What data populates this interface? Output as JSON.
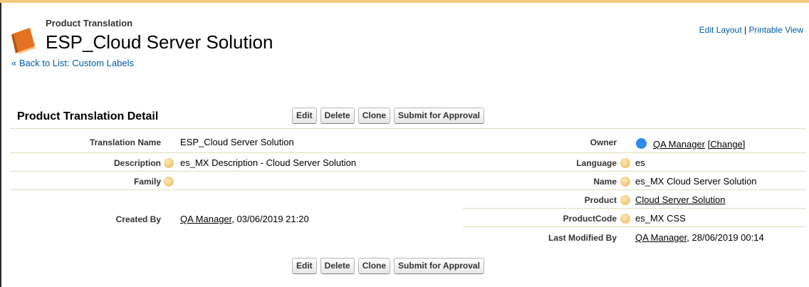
{
  "header": {
    "eyebrow": "Product Translation",
    "title": "ESP_Cloud Server Solution",
    "back_link": "« Back to List: Custom Labels",
    "edit_layout": "Edit Layout",
    "separator": "|",
    "printable_view": "Printable View"
  },
  "section": {
    "title": "Product Translation Detail"
  },
  "buttons": {
    "edit": "Edit",
    "delete": "Delete",
    "clone": "Clone",
    "submit": "Submit for Approval"
  },
  "fields": {
    "translation_name": {
      "label": "Translation Name",
      "value": "ESP_Cloud Server Solution"
    },
    "description": {
      "label": "Description",
      "value": "es_MX Description - Cloud Server Solution"
    },
    "family": {
      "label": "Family",
      "value": ""
    },
    "created_by": {
      "label": "Created By",
      "user": "QA Manager",
      "date": ", 03/06/2019 21:20"
    },
    "owner": {
      "label": "Owner",
      "user": "QA Manager",
      "change": "[Change]"
    },
    "language": {
      "label": "Language",
      "value": "es"
    },
    "name": {
      "label": "Name",
      "value": "es_MX Cloud Server Solution"
    },
    "product": {
      "label": "Product",
      "value": "Cloud Server Solution"
    },
    "product_code": {
      "label": "ProductCode",
      "value": "es_MX CSS"
    },
    "last_modified_by": {
      "label": "Last Modified By",
      "user": "QA Manager",
      "date": ", 28/06/2019 00:14"
    }
  },
  "icons": {
    "record": "book-icon",
    "help": "help-icon",
    "owner": "user-icon"
  },
  "colors": {
    "link": "#015ba7",
    "top_bar": "#f3c97a",
    "divider": "#e3deb8"
  }
}
